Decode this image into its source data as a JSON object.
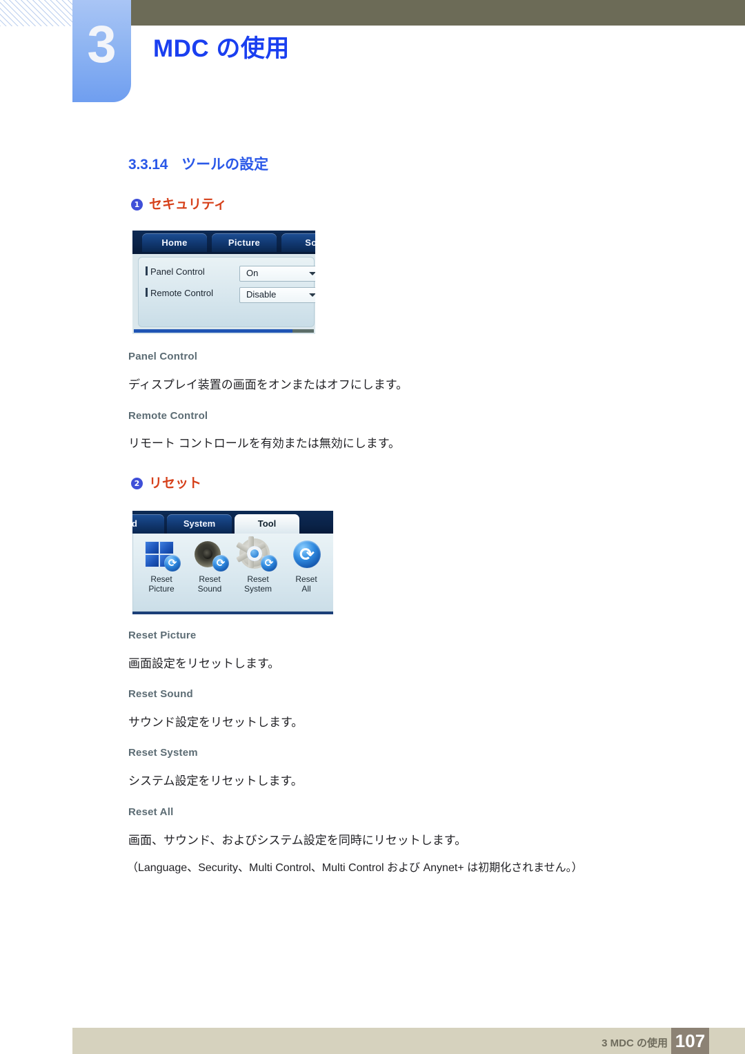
{
  "header": {
    "chapter_number": "3",
    "chapter_title": "MDC の使用",
    "accent_blue": "#1a3ff0",
    "tab_blue": "#8fb5f2",
    "olive": "#6c6b57"
  },
  "section": {
    "number": "3.3.14",
    "title": "ツールの設定"
  },
  "items": [
    {
      "badge": "1",
      "title": "セキュリティ"
    },
    {
      "badge": "2",
      "title": "リセット"
    }
  ],
  "screenshot_security": {
    "tabs": [
      "Home",
      "Picture",
      "Sou"
    ],
    "rows": [
      {
        "label": "Panel Control",
        "value": "On"
      },
      {
        "label": "Remote Control",
        "value": "Disable"
      }
    ]
  },
  "screenshot_reset": {
    "tabs": [
      "nd",
      "System",
      "Tool"
    ],
    "active_tab": "Tool",
    "buttons": [
      {
        "icon": "reset-picture-icon",
        "line1": "Reset",
        "line2": "Picture"
      },
      {
        "icon": "reset-sound-icon",
        "line1": "Reset",
        "line2": "Sound"
      },
      {
        "icon": "reset-system-icon",
        "line1": "Reset",
        "line2": "System"
      },
      {
        "icon": "reset-all-icon",
        "line1": "Reset",
        "line2": "All"
      }
    ]
  },
  "definitions": [
    {
      "term": "Panel Control",
      "desc": "ディスプレイ装置の画面をオンまたはオフにします。"
    },
    {
      "term": "Remote Control",
      "desc": "リモート コントロールを有効または無効にします。"
    },
    {
      "term": "Reset Picture",
      "desc": "画面設定をリセットします。"
    },
    {
      "term": "Reset Sound",
      "desc": "サウンド設定をリセットします。"
    },
    {
      "term": "Reset System",
      "desc": "システム設定をリセットします。"
    },
    {
      "term": "Reset All",
      "desc": "画面、サウンド、およびシステム設定を同時にリセットします。"
    }
  ],
  "note": "（Language、Security、Multi Control、Multi Control および Anynet+ は初期化されません。）",
  "footer": {
    "text": "3 MDC の使用",
    "page": "107",
    "bar_color": "#d6d2be",
    "page_box_color": "#8c8274"
  },
  "icons": {
    "refresh_glyph": "⟳",
    "dropdown_glyph": "▼"
  }
}
